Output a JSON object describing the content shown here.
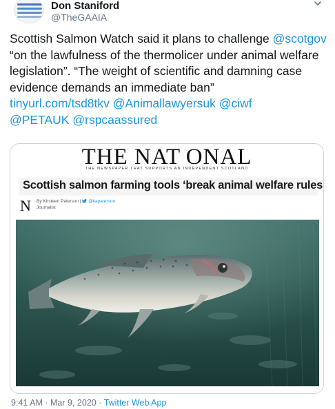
{
  "author": {
    "display_name": "Don Staniford",
    "handle": "@TheGAAIA"
  },
  "tweet": {
    "text_before": "Scottish Salmon Watch said it plans to challenge ",
    "mention_scotgov": "@scotgov",
    "text_quote": "  “on the lawfulness of the thermolicer under animal welfare legislation”. “The weight of scientific and damning case evidence demands an immediate ban”",
    "link_url": "tinyurl.com/tsd8tkv",
    "mention_1": "@Animallawyersuk",
    "mention_2": "@ciwf",
    "mention_3": "@PETAUK",
    "mention_4": "@rspcaassured"
  },
  "card": {
    "paper_name": "THE NAT ONAL",
    "paper_tagline": "THE NEWSPAPER THAT SUPPORTS AN INDEPENDENT SCOTLAND",
    "headline": "Scottish salmon farming tools ‘break animal welfare rules’",
    "logo_letter": "N",
    "byline_prefix": "By Kirsteen Paterson",
    "byline_separator": "|",
    "byline_twitter": "@kapaterson",
    "byline_role": "Journalist"
  },
  "footer": {
    "time": "9:41 AM",
    "separator": "·",
    "date": "Mar 9, 2020",
    "source": "Twitter Web App"
  },
  "colors": {
    "link": "#1b95e0",
    "muted": "#657786",
    "text": "#14171a",
    "border": "#ccd6dd"
  },
  "icons": [
    "chevron-down-icon",
    "twitter-bird-icon"
  ]
}
